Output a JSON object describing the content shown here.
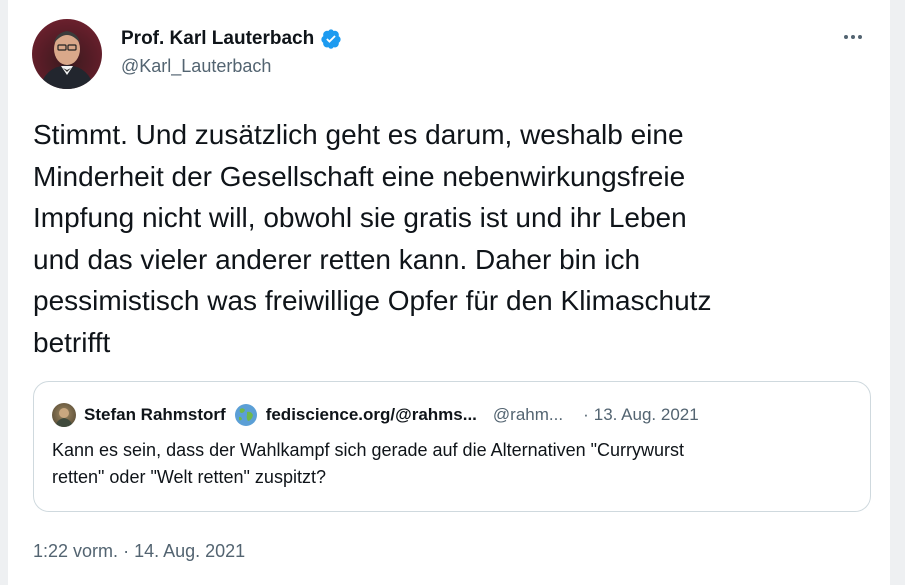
{
  "tweet": {
    "author_name": "Prof. Karl Lauterbach",
    "handle": "@Karl_Lauterbach",
    "text": "Stimmt. Und zusätzlich geht es darum, weshalb eine\nMinderheit der Gesellschaft eine nebenwirkungsfreie\nImpfung nicht will, obwohl sie gratis ist und ihr Leben\nund das vieler anderer retten kann. Daher bin ich\npessimistisch was freiwillige Opfer für den Klimaschutz\nbetrifft",
    "time": "1:22 vorm.",
    "separator": "·",
    "date": "14. Aug. 2021"
  },
  "quoted": {
    "author_name": "Stefan Rahmstorf",
    "site": "fediscience.org/@rahms...",
    "handle": "@rahm...",
    "separator": "·",
    "date": "13. Aug. 2021",
    "text": "Kann es sein, dass der Wahlkampf sich gerade auf die Alternativen \"Currywurst\nretten\" oder \"Welt retten\" zuspitzt?"
  },
  "icons": {
    "verified": "verified-badge-icon",
    "more": "more-options-icon",
    "globe": "globe-emoji-icon"
  },
  "colors": {
    "text_primary": "#0f1419",
    "text_secondary": "#536471",
    "verified_blue": "#1d9bf0",
    "border": "#cfd9de"
  }
}
